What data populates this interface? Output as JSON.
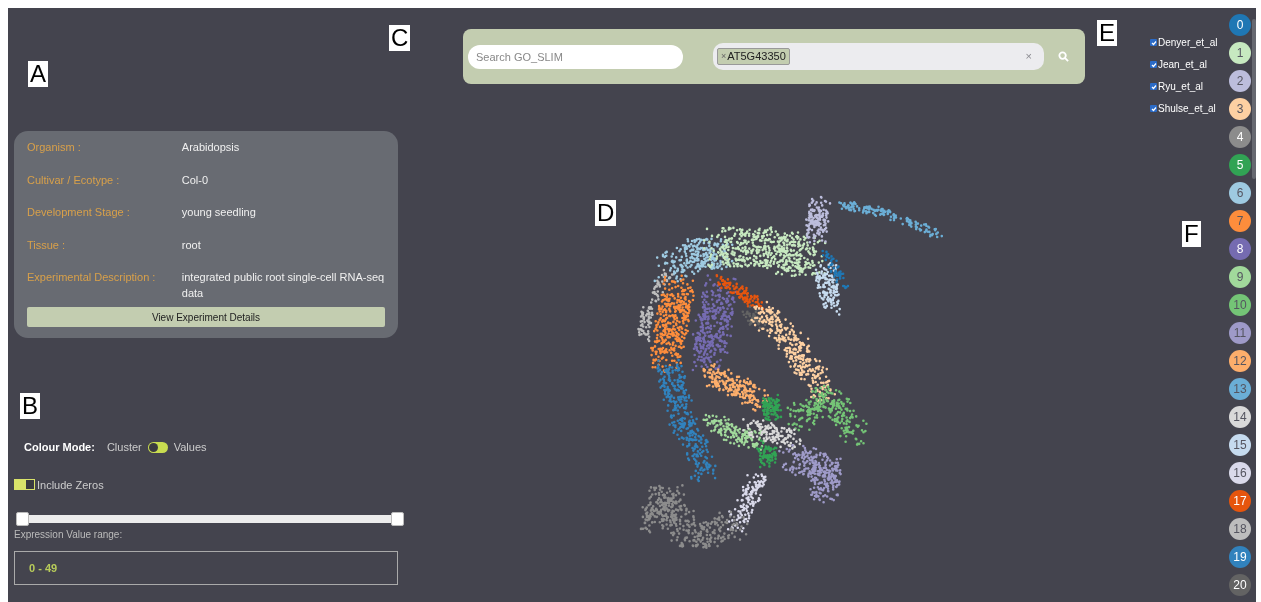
{
  "panel_labels": [
    "A",
    "B",
    "C",
    "D",
    "E",
    "F"
  ],
  "experiment": {
    "fields": [
      {
        "label": "Organism :",
        "value": "Arabidopsis"
      },
      {
        "label": "Cultivar / Ecotype :",
        "value": "Col-0"
      },
      {
        "label": "Development Stage :",
        "value": "young seedling"
      },
      {
        "label": "Tissue :",
        "value": "root"
      },
      {
        "label": "Experimental Description :",
        "value": "integrated public root single-cell RNA-seq data"
      }
    ],
    "button": "View Experiment Details"
  },
  "colour_mode": {
    "label": "Colour Mode:",
    "left": "Cluster",
    "right": "Values",
    "on": false
  },
  "include_zeros": {
    "label": "Include Zeros",
    "on": true
  },
  "range_slider": {
    "thumbs": [
      {
        "level": 0
      },
      {
        "level": 1
      }
    ],
    "label": "Expression Value range:",
    "value": "0 - 49"
  },
  "search": {
    "placeholder": "Search GO_SLIM",
    "tags": [
      {
        "remove": "×",
        "text": "AT5G43350"
      }
    ],
    "clear": "×"
  },
  "datasets": [
    {
      "label": "Denyer_et_al",
      "checked": true
    },
    {
      "label": "Jean_et_al",
      "checked": true
    },
    {
      "label": "Ryu_et_al",
      "checked": true
    },
    {
      "label": "Shulse_et_al",
      "checked": true
    }
  ],
  "clusters": [
    {
      "label": "0",
      "color": "#1f77b4"
    },
    {
      "label": "1",
      "color": "#c7e9c0"
    },
    {
      "label": "2",
      "color": "#bcbddc"
    },
    {
      "label": "3",
      "color": "#fdd0a2"
    },
    {
      "label": "4",
      "color": "#8c8c8c"
    },
    {
      "label": "5",
      "color": "#31a354"
    },
    {
      "label": "6",
      "color": "#9ecae1"
    },
    {
      "label": "7",
      "color": "#fd8d3c"
    },
    {
      "label": "8",
      "color": "#756bb1"
    },
    {
      "label": "9",
      "color": "#a1d99b"
    },
    {
      "label": "10",
      "color": "#74c476"
    },
    {
      "label": "11",
      "color": "#9e9ac8"
    },
    {
      "label": "12",
      "color": "#fdae6b"
    },
    {
      "label": "13",
      "color": "#6baed6"
    },
    {
      "label": "14",
      "color": "#d9d9d9"
    },
    {
      "label": "15",
      "color": "#c6dbef"
    },
    {
      "label": "16",
      "color": "#dadaeb"
    },
    {
      "label": "17",
      "color": "#e6550d"
    },
    {
      "label": "18",
      "color": "#bdbdbd"
    },
    {
      "label": "19",
      "color": "#3182bd"
    },
    {
      "label": "20",
      "color": "#636363"
    }
  ]
}
